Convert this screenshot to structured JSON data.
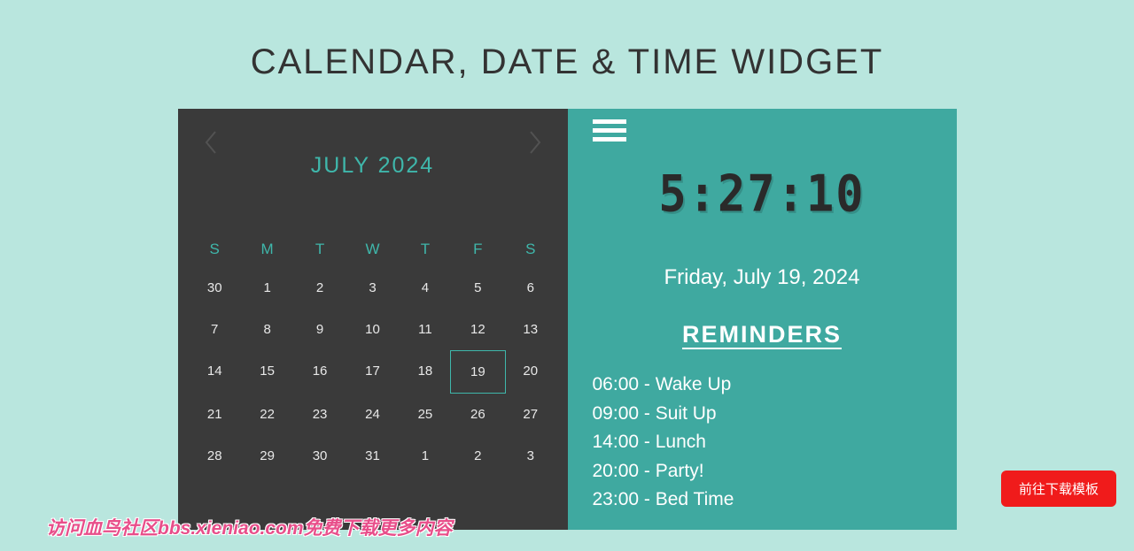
{
  "title": "CALENDAR, DATE & TIME WIDGET",
  "calendar": {
    "month_label": "JULY 2024",
    "days_of_week": [
      "S",
      "M",
      "T",
      "W",
      "T",
      "F",
      "S"
    ],
    "cells": [
      "30",
      "1",
      "2",
      "3",
      "4",
      "5",
      "6",
      "7",
      "8",
      "9",
      "10",
      "11",
      "12",
      "13",
      "14",
      "15",
      "16",
      "17",
      "18",
      "19",
      "20",
      "21",
      "22",
      "23",
      "24",
      "25",
      "26",
      "27",
      "28",
      "29",
      "30",
      "31",
      "1",
      "2",
      "3"
    ],
    "today_index": 19
  },
  "clock": {
    "time": "5:27:10",
    "date": "Friday, July 19, 2024"
  },
  "reminders": {
    "heading": "REMINDERS",
    "items": [
      "06:00 - Wake Up",
      "09:00 - Suit Up",
      "14:00 - Lunch",
      "20:00 - Party!",
      "23:00 - Bed Time"
    ]
  },
  "download_label": "前往下载模板",
  "footer_text": "访问血鸟社区bbs.xieniao.com免费下载更多内容"
}
